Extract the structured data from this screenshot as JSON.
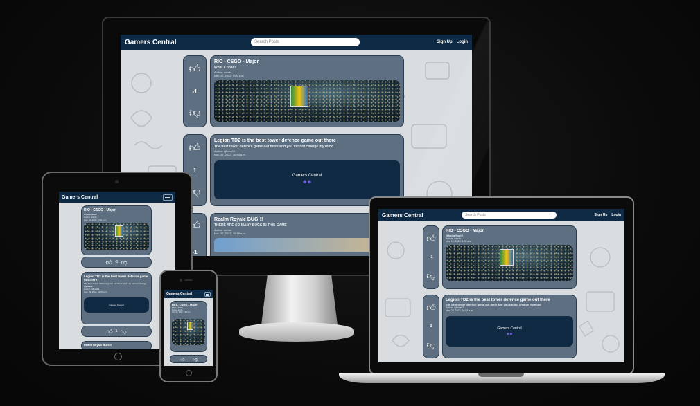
{
  "site": {
    "brand": "Gamers Central",
    "search_placeholder": "Search Posts",
    "nav_signup": "Sign Up",
    "nav_login": "Login"
  },
  "posts": [
    {
      "title": "RIO - CSGO - Major",
      "subtitle": "What a final!!",
      "author": "Author: admin",
      "date": "Nov. 22, 2022, 1:00 a.m.",
      "votes": "-1",
      "image": "stadium-crowd"
    },
    {
      "title": "Legion TD2 is the best tower defence game out there",
      "subtitle": "The best tower defence game out there and you cannot change my mind",
      "author": "Author: cjBrea83",
      "date": "Nov. 22, 2022, 10:53 a.m.",
      "votes": "1",
      "image_label": "Gamers Central"
    },
    {
      "title": "Realm Royale BUG!!!",
      "subtitle": "THERE ARE SO MANY BUGS IN THIS GAME",
      "author": "Author: admin",
      "date": "Nov. 22, 2022, 10:48 a.m.",
      "votes": "-1"
    }
  ],
  "icons": {
    "upvote": "thumbs-up-icon",
    "downvote": "thumbs-down-icon",
    "menu": "hamburger-menu-icon",
    "gamepad": "gamepad-icon"
  },
  "colors": {
    "navbar": "#0e2a45",
    "card": "#5d6f80",
    "logo_box": "#102a44",
    "background": "#d9dde0"
  }
}
